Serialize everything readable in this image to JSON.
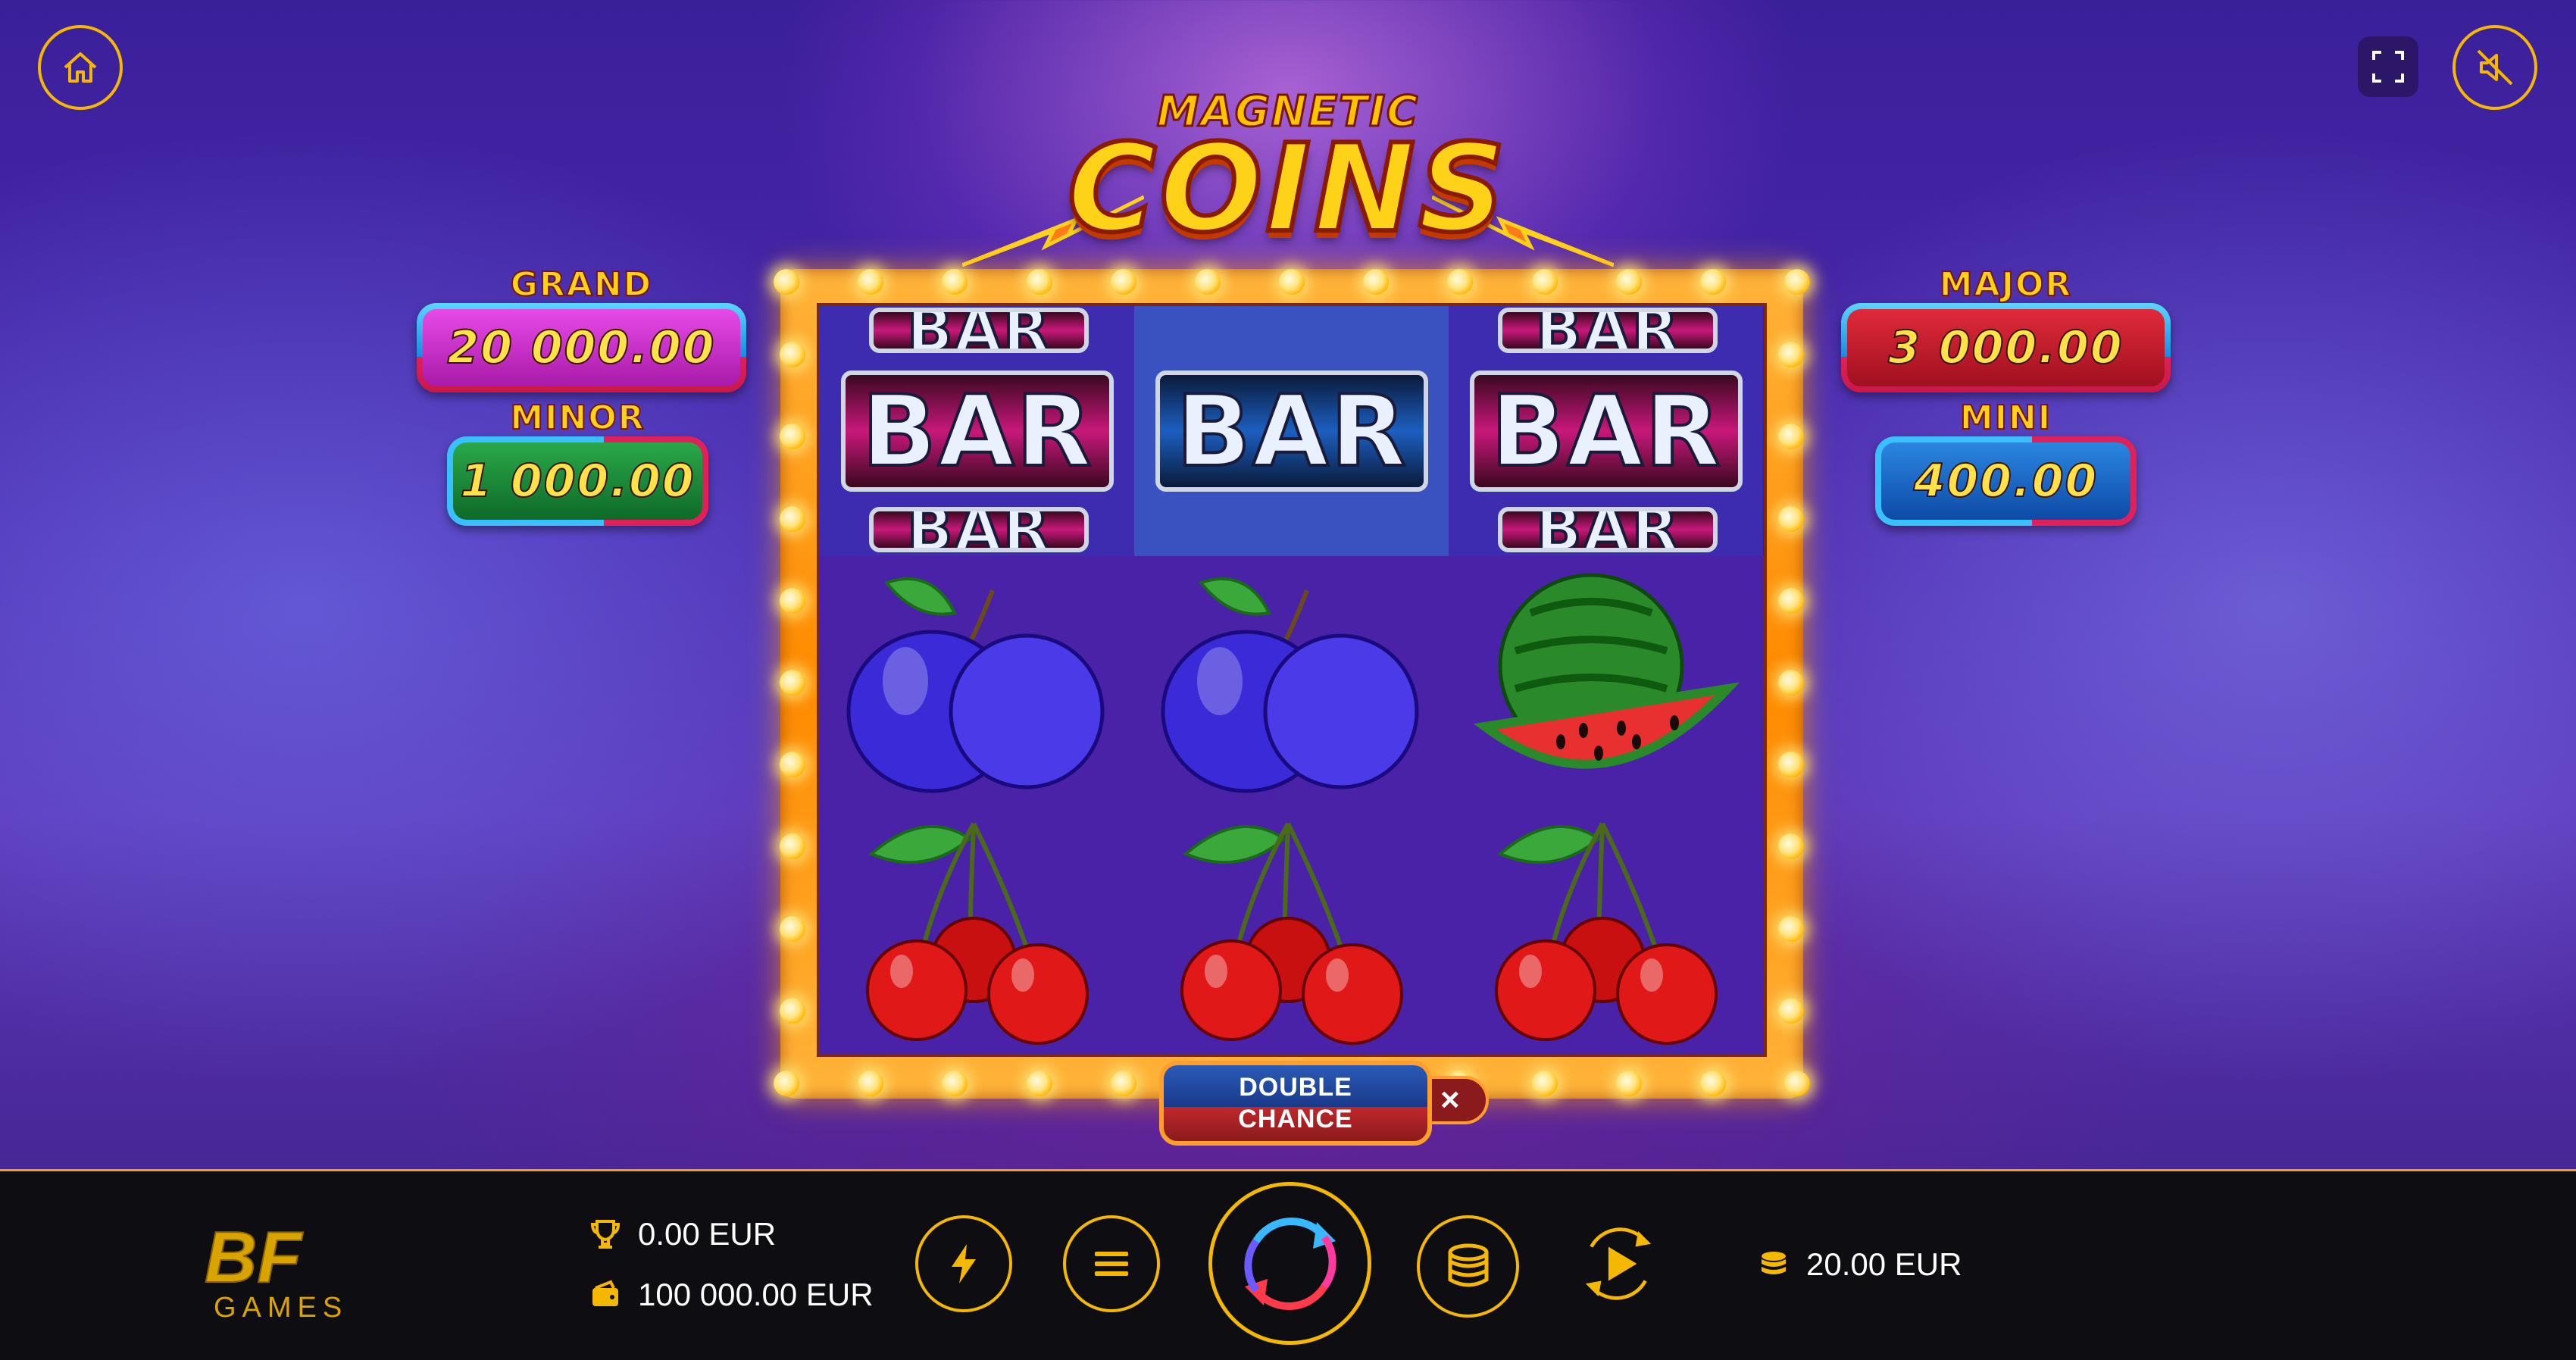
{
  "header": {
    "home_icon": "home-icon",
    "fullscreen_icon": "fullscreen-icon",
    "sound_icon": "sound-muted-icon"
  },
  "logo": {
    "line1": "MAGNETIC",
    "line2": "COINS"
  },
  "jackpots": {
    "grand": {
      "label": "GRAND",
      "value": "20 000.00",
      "color": "#c81fc8"
    },
    "minor": {
      "label": "MINOR",
      "value": "1 000.00",
      "color": "#1a8a3a"
    },
    "major": {
      "label": "MAJOR",
      "value": "3 000.00",
      "color": "#c81a2a"
    },
    "mini": {
      "label": "MINI",
      "value": "400.00",
      "color": "#1a6ad0"
    }
  },
  "reels": {
    "row1": [
      "BAR",
      "BAR",
      "BAR"
    ],
    "row1_partial_top": [
      "BAR",
      "",
      "BAR"
    ],
    "row1_partial_bottom": [
      "BAR",
      "",
      "BAR"
    ],
    "row2": [
      "plum",
      "plum",
      "watermelon"
    ],
    "row3": [
      "cherries",
      "cherries",
      "cherries"
    ]
  },
  "double_chance": {
    "line1": "DOUBLE",
    "line2": "CHANCE",
    "toggle_close": "×"
  },
  "footer": {
    "brand": "BF",
    "brand_sub": "GAMES",
    "win": "0.00 EUR",
    "balance": "100 000.00 EUR",
    "bet": "20.00 EUR",
    "icons": [
      "turbo-icon",
      "menu-icon",
      "spin-icon",
      "coins-icon",
      "autoplay-icon"
    ]
  }
}
